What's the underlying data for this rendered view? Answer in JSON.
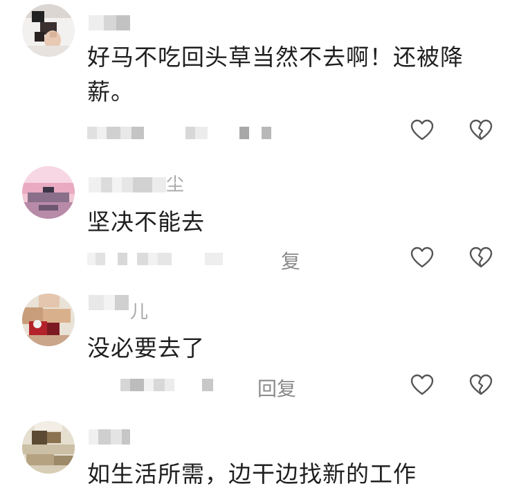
{
  "comments": [
    {
      "username": "",
      "text": "好马不吃回头草当然不去啊！还被降薪。",
      "reply_label": "",
      "like_icon": "heart-outline-icon",
      "dislike_icon": "broken-heart-icon"
    },
    {
      "username": "尘",
      "text": "坚决不能去",
      "reply_label": "复",
      "like_icon": "heart-outline-icon",
      "dislike_icon": "broken-heart-icon"
    },
    {
      "username": "儿",
      "text": "没必要去了",
      "reply_label": "回复",
      "like_icon": "heart-outline-icon",
      "dislike_icon": "broken-heart-icon"
    },
    {
      "username": "",
      "text": "如生活所需，边干边找新的工作",
      "reply_label": "",
      "like_icon": "heart-outline-icon",
      "dislike_icon": "broken-heart-icon"
    }
  ],
  "colors": {
    "text": "#1f1f1f",
    "muted": "#8a8a8a",
    "icon_stroke": "#555555",
    "mosaic_light": "#e3e3e3",
    "mosaic_mid": "#c8c8c8",
    "mosaic_dark": "#8c8c8c"
  }
}
